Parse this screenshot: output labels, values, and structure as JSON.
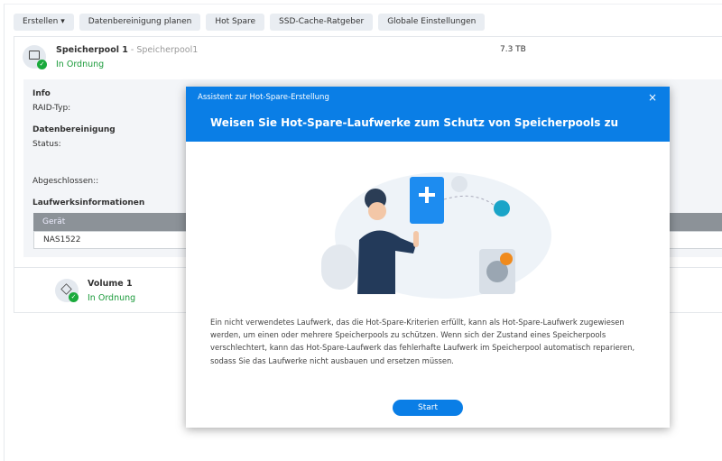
{
  "toolbar": {
    "create": "Erstellen",
    "scrub": "Datenbereinigung planen",
    "hotspare": "Hot Spare",
    "ssd": "SSD-Cache-Ratgeber",
    "global": "Globale Einstellungen"
  },
  "pool": {
    "name": "Speicherpool 1",
    "sep": " - ",
    "sub": "Speicherpool1",
    "status": "In Ordnung",
    "size": "7.3 TB"
  },
  "details": {
    "info": "Info",
    "raid": "RAID-Typ:",
    "scrub": "Datenbereinigung",
    "status": "Status:",
    "done": "Abgeschlossen::",
    "drives": "Laufwerksinformationen",
    "col_device": "Gerät",
    "device": "NAS1522"
  },
  "volume": {
    "name": "Volume 1",
    "status": "In Ordnung"
  },
  "dialog": {
    "window_title": "Assistent zur Hot-Spare-Erstellung",
    "title": "Weisen Sie Hot-Spare-Laufwerke zum Schutz von Speicherpools zu",
    "text": "Ein nicht verwendetes Laufwerk, das die Hot-Spare-Kriterien erfüllt, kann als Hot-Spare-Laufwerk zugewiesen werden, um einen oder mehrere Speicherpools zu schützen. Wenn sich der Zustand eines Speicherpools verschlechtert, kann das Hot-Spare-Laufwerk das fehlerhafte Laufwerk im Speicherpool automatisch reparieren, sodass Sie das Laufwerke nicht ausbauen und ersetzen müssen.",
    "start": "Start"
  },
  "colors": {
    "accent": "#0a7ee6",
    "ok": "#1a9a3a"
  }
}
